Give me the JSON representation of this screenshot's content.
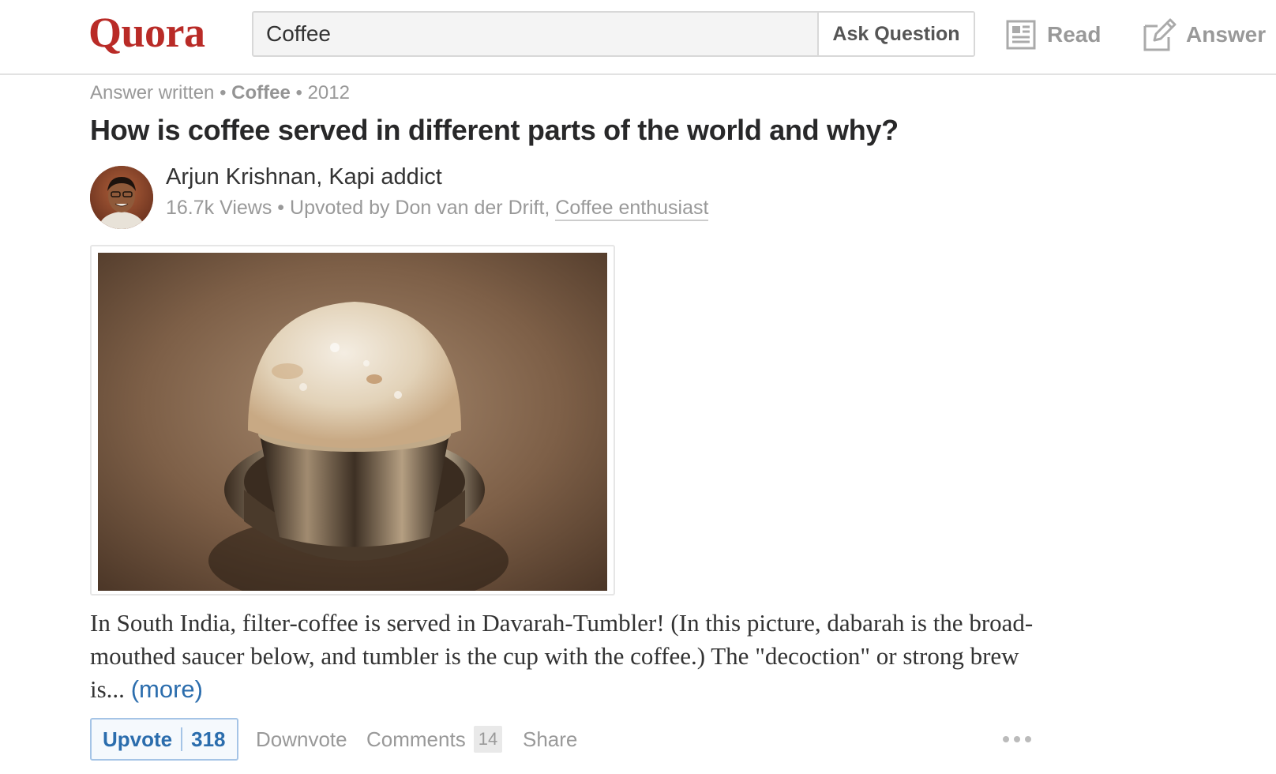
{
  "header": {
    "logo_text": "Quora",
    "search": {
      "value": "Coffee",
      "placeholder": ""
    },
    "ask_label": "Ask Question",
    "nav": {
      "read_label": "Read",
      "answer_label": "Answer"
    }
  },
  "post": {
    "meta": {
      "type": "Answer written",
      "topic": "Coffee",
      "year": "2012",
      "separator": "•"
    },
    "question": "How is coffee served in different parts of the world and why?",
    "author": "Arjun Krishnan, Kapi addict",
    "stats": {
      "views": "16.7k Views",
      "upvoted_by": "Upvoted by Don van der Drift,",
      "credential": "Coffee enthusiast"
    },
    "answer_text": "In South India, filter-coffee is served in Davarah-Tumbler! (In this picture, dabarah is the broad-mouthed saucer below, and tumbler is the cup with the coffee.) The \"decoction\" or strong brew is...",
    "more_label": "(more)"
  },
  "actions": {
    "upvote_label": "Upvote",
    "upvote_count": "318",
    "downvote_label": "Downvote",
    "comments_label": "Comments",
    "comments_count": "14",
    "share_label": "Share"
  },
  "icons": {
    "read": "newspaper-icon",
    "answer": "pencil-edit-icon",
    "overflow": "more-dots-icon"
  },
  "colors": {
    "brand": "#b92b27",
    "link": "#2b6dad",
    "muted": "#999999"
  }
}
